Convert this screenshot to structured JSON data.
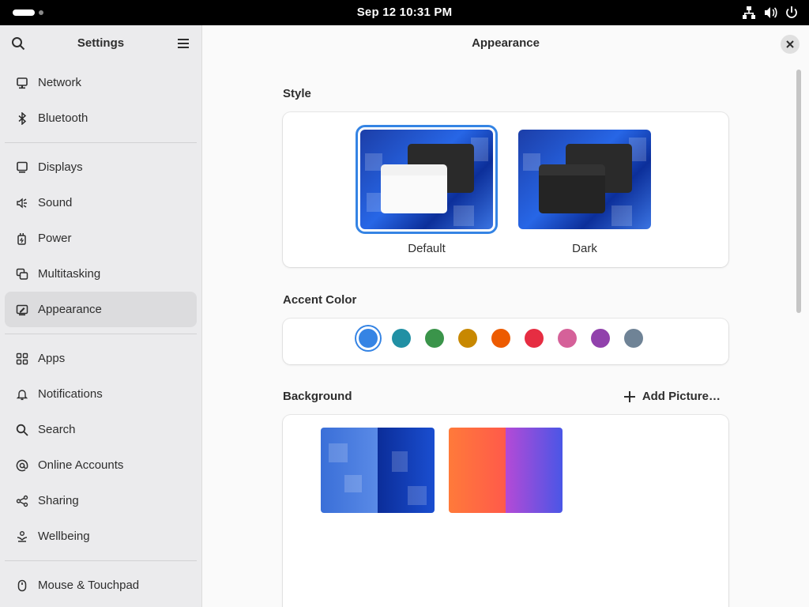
{
  "topbar": {
    "clock": "Sep 12  10:31 PM"
  },
  "sidebar": {
    "title": "Settings",
    "groups": [
      [
        {
          "label": "Network",
          "icon": "network-icon"
        },
        {
          "label": "Bluetooth",
          "icon": "bluetooth-icon"
        }
      ],
      [
        {
          "label": "Displays",
          "icon": "display-icon"
        },
        {
          "label": "Sound",
          "icon": "sound-icon"
        },
        {
          "label": "Power",
          "icon": "power-plug-icon"
        },
        {
          "label": "Multitasking",
          "icon": "multitasking-icon"
        },
        {
          "label": "Appearance",
          "icon": "appearance-icon",
          "active": true
        }
      ],
      [
        {
          "label": "Apps",
          "icon": "apps-grid-icon"
        },
        {
          "label": "Notifications",
          "icon": "bell-icon"
        },
        {
          "label": "Search",
          "icon": "search-icon"
        },
        {
          "label": "Online Accounts",
          "icon": "at-icon"
        },
        {
          "label": "Sharing",
          "icon": "share-icon"
        },
        {
          "label": "Wellbeing",
          "icon": "wellbeing-icon"
        }
      ],
      [
        {
          "label": "Mouse & Touchpad",
          "icon": "mouse-icon"
        }
      ]
    ]
  },
  "main": {
    "title": "Appearance",
    "style": {
      "label": "Style",
      "options": [
        {
          "name": "Default",
          "selected": true
        },
        {
          "name": "Dark",
          "selected": false
        }
      ]
    },
    "accent": {
      "label": "Accent Color",
      "colors": [
        "#3584e4",
        "#2190a4",
        "#3a944a",
        "#c88800",
        "#ed5b00",
        "#e62d42",
        "#d56199",
        "#9141ac",
        "#6f8396"
      ],
      "selected_index": 0
    },
    "background": {
      "label": "Background",
      "add_label": "Add Picture…"
    }
  }
}
